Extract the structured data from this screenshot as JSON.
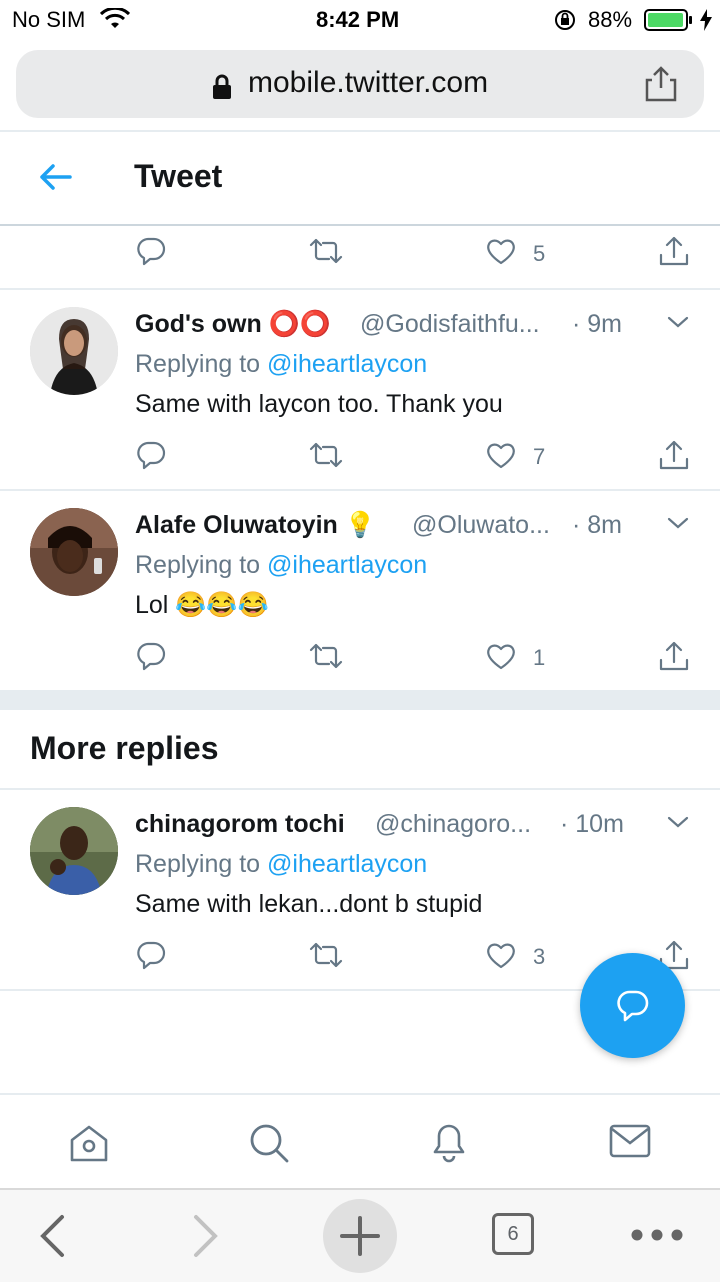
{
  "status": {
    "carrier": "No SIM",
    "time": "8:42 PM",
    "battery": "88%"
  },
  "browser": {
    "url": "mobile.twitter.com",
    "tab_count": "6"
  },
  "header": {
    "title": "Tweet"
  },
  "top_actions": {
    "like_count": "5"
  },
  "tweets": [
    {
      "name": "God's own ⭕⭕",
      "handle": "@Godisfaithfu...",
      "time": "· 9m",
      "replying_prefix": "Replying to ",
      "mention": "@iheartlaycon",
      "text": "Same with laycon too. Thank you",
      "like_count": "7"
    },
    {
      "name": "Alafe Oluwatoyin 💡",
      "handle": "@Oluwato...",
      "time": "· 8m",
      "replying_prefix": "Replying to ",
      "mention": "@iheartlaycon",
      "text": "Lol 😂😂😂",
      "like_count": "1"
    },
    {
      "name": "chinagorom tochi",
      "handle": "@chinagoro...",
      "time": "· 10m",
      "replying_prefix": "Replying to ",
      "mention": "@iheartlaycon",
      "text": "Same with lekan...dont b stupid",
      "like_count": "3"
    }
  ],
  "more_replies": {
    "title": "More replies"
  },
  "colors": {
    "accent": "#1da1f2",
    "muted": "#657786",
    "battery": "#4cd964"
  }
}
